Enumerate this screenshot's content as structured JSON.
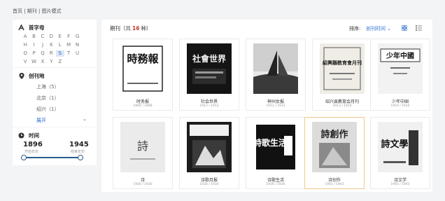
{
  "breadcrumb": "首页 | 期刊 | 图片模式",
  "sidebar": {
    "alphabet": {
      "title": "首字母",
      "active": "S",
      "letters": [
        "A",
        "B",
        "C",
        "D",
        "E",
        "F",
        "G",
        "H",
        "I",
        "J",
        "K",
        "L",
        "M",
        "N",
        "O",
        "P",
        "Q",
        "R",
        "S",
        "T",
        "U",
        "V",
        "W",
        "X",
        "Y",
        "Z"
      ]
    },
    "places": {
      "title": "创刊地",
      "items": [
        "上海（5）",
        "北京（1）",
        "绍兴（1）"
      ],
      "expand_label": "展开"
    },
    "time": {
      "title": "时间",
      "start_year": "1896",
      "end_year": "1945",
      "start_label": "开始年份",
      "end_label": "结束年份"
    }
  },
  "main": {
    "title_prefix": "期刊（共",
    "count": "16",
    "title_suffix": "种）",
    "sort_label": "排序:",
    "sort_value": "创刊时间 ⌄"
  },
  "cards": [
    {
      "title": "时务报",
      "years": "1896 / 1898",
      "cover_text": "時務報"
    },
    {
      "title": "社会世界",
      "years": "1912 / 1912",
      "cover_text": "社會世界"
    },
    {
      "title": "神州女报",
      "years": "1912 / 1913"
    },
    {
      "title": "绍兴县教育会月刊",
      "years": "1913 / 1914",
      "cover_text": "紹興縣教育會月刊"
    },
    {
      "title": "少年中国",
      "years": "1919 / 1924",
      "cover_text": "少年中國"
    },
    {
      "title": "诗",
      "years": "1926 / 1930",
      "cover_text": "詩"
    },
    {
      "title": "诗歌月报",
      "years": "1934 / 1934"
    },
    {
      "title": "诗歌生活",
      "years": "1936 / 1936",
      "cover_text": "詩歌生活"
    },
    {
      "title": "诗创作",
      "years": "1941 / 1943",
      "cover_text": "詩創作"
    },
    {
      "title": "诗文学",
      "years": "1945 / 1945",
      "cover_text": "詩文學"
    }
  ]
}
